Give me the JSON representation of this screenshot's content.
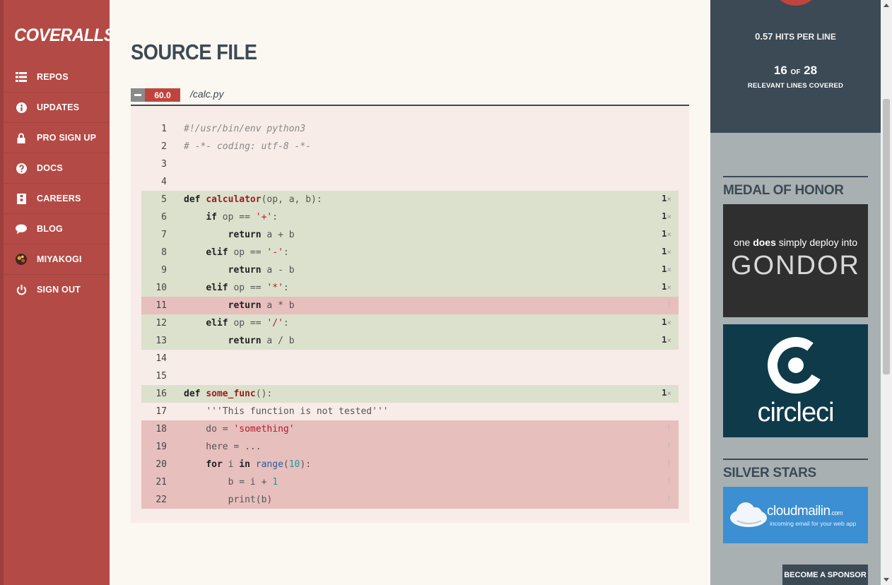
{
  "sidebar": {
    "logo": "COVERALLS",
    "items": [
      {
        "label": "REPOS",
        "icon": "list-icon"
      },
      {
        "label": "UPDATES",
        "icon": "info-icon"
      },
      {
        "label": "PRO SIGN UP",
        "icon": "lock-icon"
      },
      {
        "label": "DOCS",
        "icon": "question-icon"
      },
      {
        "label": "CAREERS",
        "icon": "badge-icon"
      },
      {
        "label": "BLOG",
        "icon": "chat-bubble-icon"
      },
      {
        "label": "MIYAKOGI",
        "icon": "avatar-icon"
      },
      {
        "label": "SIGN OUT",
        "icon": "power-icon"
      }
    ]
  },
  "main": {
    "title": "SOURCE FILE",
    "coverage_pct": "60.0",
    "file_path": "/calc.py",
    "lines": [
      {
        "n": "1",
        "status": "none",
        "hits": ""
      },
      {
        "n": "2",
        "status": "none",
        "hits": ""
      },
      {
        "n": "3",
        "status": "none",
        "hits": ""
      },
      {
        "n": "4",
        "status": "none",
        "hits": ""
      },
      {
        "n": "5",
        "status": "hit",
        "hits": "1"
      },
      {
        "n": "6",
        "status": "hit",
        "hits": "1"
      },
      {
        "n": "7",
        "status": "hit",
        "hits": "1"
      },
      {
        "n": "8",
        "status": "hit",
        "hits": "1"
      },
      {
        "n": "9",
        "status": "hit",
        "hits": "1"
      },
      {
        "n": "10",
        "status": "hit",
        "hits": "1"
      },
      {
        "n": "11",
        "status": "miss",
        "hits": "!"
      },
      {
        "n": "12",
        "status": "hit",
        "hits": "1"
      },
      {
        "n": "13",
        "status": "hit",
        "hits": "1"
      },
      {
        "n": "14",
        "status": "none",
        "hits": ""
      },
      {
        "n": "15",
        "status": "none",
        "hits": ""
      },
      {
        "n": "16",
        "status": "hit",
        "hits": "1"
      },
      {
        "n": "17",
        "status": "none",
        "hits": ""
      },
      {
        "n": "18",
        "status": "miss",
        "hits": "!"
      },
      {
        "n": "19",
        "status": "miss",
        "hits": "!"
      },
      {
        "n": "20",
        "status": "miss",
        "hits": "!"
      },
      {
        "n": "21",
        "status": "miss",
        "hits": "!"
      },
      {
        "n": "22",
        "status": "miss",
        "hits": "!"
      }
    ],
    "code": [
      "#!/usr/bin/env python3",
      "# -*- coding: utf-8 -*-",
      "",
      "",
      "def calculator(op, a, b):",
      "    if op == '+':",
      "        return a + b",
      "    elif op == '-':",
      "        return a - b",
      "    elif op == '*':",
      "        return a * b",
      "    elif op == '/':",
      "        return a / b",
      "",
      "",
      "def some_func():",
      "    '''This function is not tested'''",
      "    do = 'something'",
      "    here = ...",
      "    for i in range(10):",
      "        b = i + 1",
      "        print(b)"
    ]
  },
  "stats": {
    "hits_per_line_value": "0.57",
    "hits_per_line_label": "HITS PER LINE",
    "covered": "16",
    "of": "OF",
    "relevant": "28",
    "covered_label": "RELEVANT LINES COVERED"
  },
  "sponsors": {
    "medal_title": "MEDAL OF HONOR",
    "gondor_line1_a": "one",
    "gondor_line1_b": "does",
    "gondor_line1_c": "simply deploy into",
    "gondor_line2": "GONDOR",
    "circleci": "circleci",
    "silver_title": "SILVER STARS",
    "cloudmailin": "cloudmailin",
    "cloudmailin_com": ".com",
    "cloudmailin_tag": "incoming email for your web app",
    "become": "BECOME A SPONSOR"
  },
  "colors": {
    "sidebar": "#b44a45",
    "dark": "#3b4a55",
    "hit": "#dbe1cc",
    "miss": "#e7bfbd"
  }
}
